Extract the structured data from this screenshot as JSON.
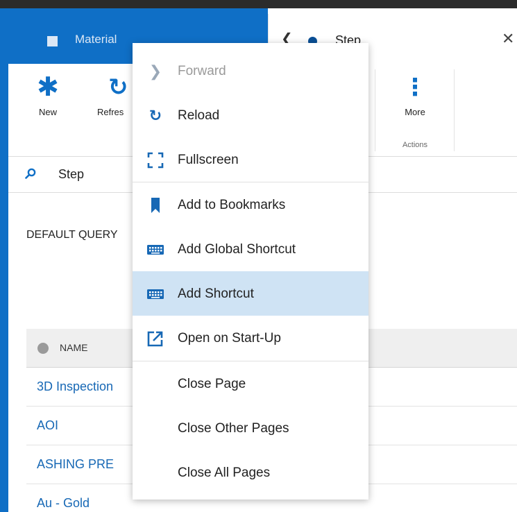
{
  "tabs": [
    {
      "label": "Material"
    },
    {
      "label": "Step",
      "back_icon": "chevron-left-icon",
      "close_icon": "close-icon"
    }
  ],
  "ribbon": {
    "buttons": [
      {
        "label": "New",
        "icon": "asterisk-icon"
      },
      {
        "label": "Refres",
        "icon": "refresh-icon"
      },
      {
        "label": "More",
        "icon": "more-vertical-icon"
      }
    ],
    "group_label": "Actions"
  },
  "search": {
    "label": "Step",
    "icon": "search-icon"
  },
  "query_label": "DEFAULT QUERY",
  "table": {
    "header": "NAME",
    "rows": [
      "3D Inspection",
      "AOI",
      "ASHING PRE",
      "Au - Gold"
    ]
  },
  "context_menu": {
    "items": [
      {
        "label": "Forward",
        "icon": "chevron-right-icon",
        "disabled": true
      },
      {
        "label": "Reload",
        "icon": "refresh-icon"
      },
      {
        "label": "Fullscreen",
        "icon": "fullscreen-icon"
      },
      {
        "label": "Add to Bookmarks",
        "icon": "bookmark-icon"
      },
      {
        "label": "Add Global Shortcut",
        "icon": "keyboard-icon"
      },
      {
        "label": "Add Shortcut",
        "icon": "keyboard-icon",
        "highlighted": true
      },
      {
        "label": "Open on Start-Up",
        "icon": "open-external-icon"
      },
      {
        "label": "Close Page"
      },
      {
        "label": "Close Other Pages"
      },
      {
        "label": "Close All Pages"
      }
    ]
  },
  "colors": {
    "accent": "#0f6fc6",
    "highlight": "#cfe3f4",
    "link": "#1768b5"
  }
}
